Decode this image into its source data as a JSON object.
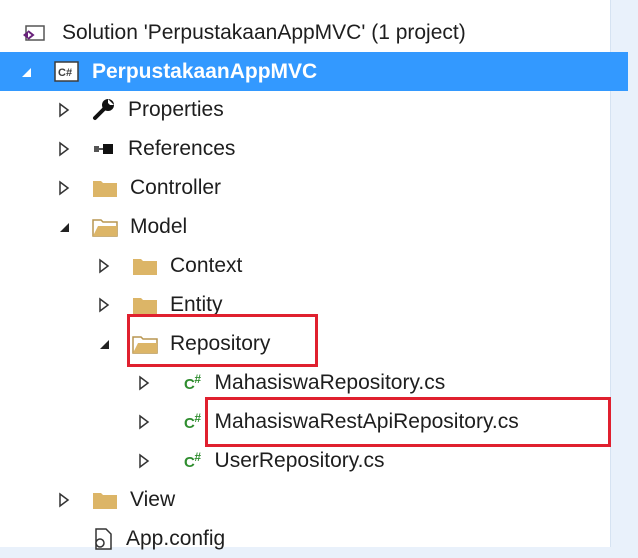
{
  "solution_explorer": {
    "solution": {
      "label": "Solution 'PerpustakaanAppMVC' (1 project)",
      "icon": "solution-icon"
    },
    "project": {
      "label": "PerpustakaanAppMVC",
      "icon": "csharp-project-icon",
      "selected": true
    },
    "items": [
      {
        "key": "properties",
        "label": "Properties",
        "icon": "wrench-icon",
        "expanded": false
      },
      {
        "key": "references",
        "label": "References",
        "icon": "references-icon",
        "expanded": false
      },
      {
        "key": "controller",
        "label": "Controller",
        "icon": "folder-icon",
        "expanded": false
      },
      {
        "key": "model",
        "label": "Model",
        "icon": "folder-open-icon",
        "expanded": true
      },
      {
        "key": "context",
        "label": "Context",
        "icon": "folder-icon",
        "expanded": false
      },
      {
        "key": "entity",
        "label": "Entity",
        "icon": "folder-icon",
        "expanded": false
      },
      {
        "key": "repository",
        "label": "Repository",
        "icon": "folder-open-icon",
        "expanded": true,
        "highlighted": true
      },
      {
        "key": "mahasiswa-repository",
        "label": "MahasiswaRepository.cs",
        "icon": "csharp-file-icon",
        "expanded": false
      },
      {
        "key": "mahasiswa-rest-api-repository",
        "label": "MahasiswaRestApiRepository.cs",
        "icon": "csharp-file-icon",
        "expanded": false,
        "highlighted": true
      },
      {
        "key": "user-repository",
        "label": "UserRepository.cs",
        "icon": "csharp-file-icon",
        "expanded": false
      },
      {
        "key": "view",
        "label": "View",
        "icon": "folder-icon",
        "expanded": false
      },
      {
        "key": "app-config",
        "label": "App.config",
        "icon": "config-file-icon"
      }
    ],
    "csharp_badge": "C#",
    "colors": {
      "selection": "#3399ff",
      "folder": "#dcb567",
      "highlight_box": "#e0202f",
      "csharp": "#2f8d2f"
    }
  }
}
